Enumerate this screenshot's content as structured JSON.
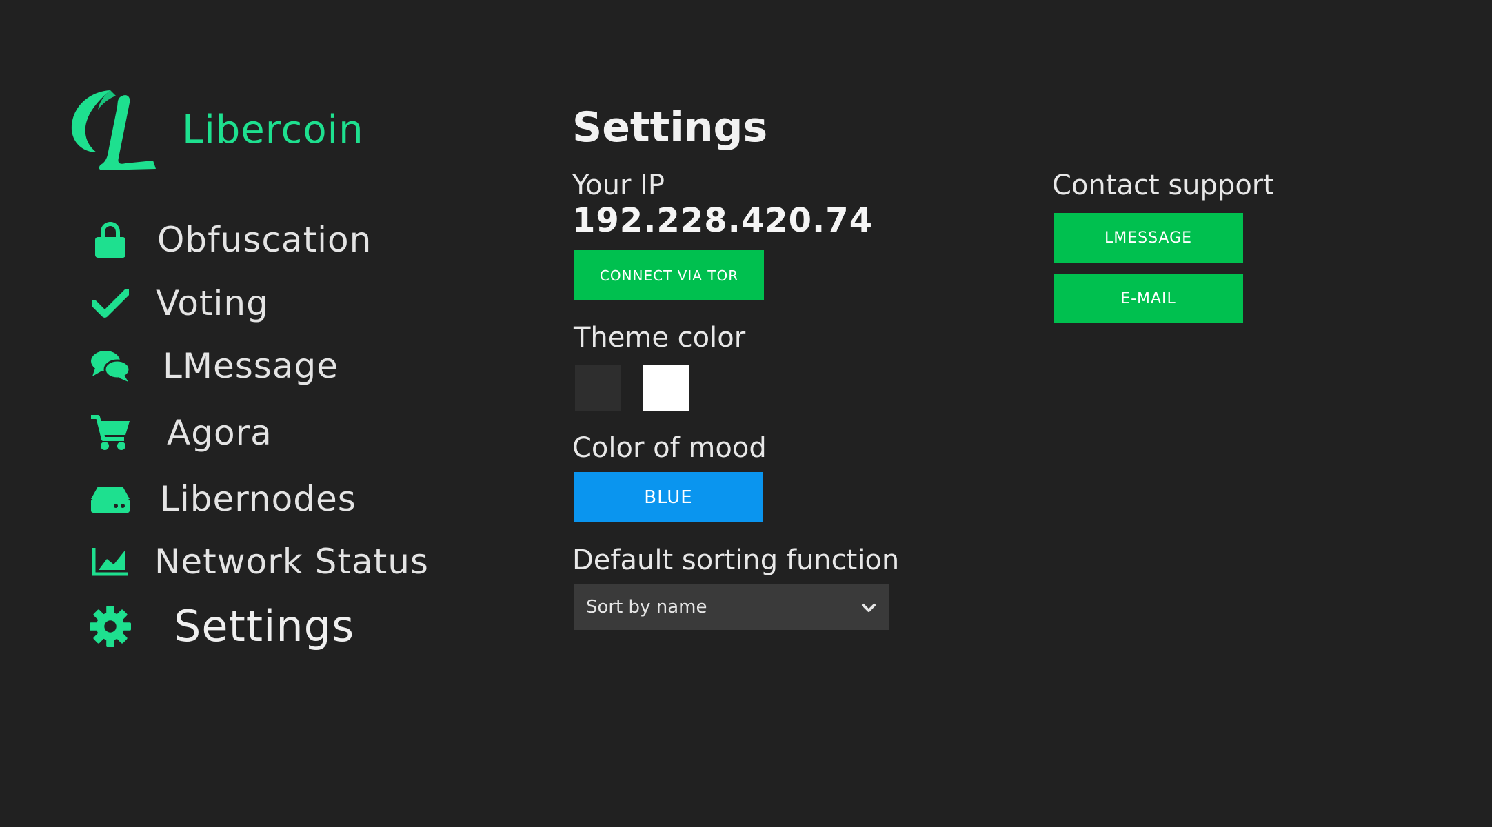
{
  "sidebar": {
    "brand": {
      "name": "Libercoin",
      "logo_icon": "libercoin-logo",
      "accent_color": "#1ee08f"
    },
    "items": [
      {
        "label": "Obfuscation",
        "icon": "lock-icon"
      },
      {
        "label": "Voting",
        "icon": "checkmark-icon"
      },
      {
        "label": "LMessage",
        "icon": "chat-bubbles-icon"
      },
      {
        "label": "Agora",
        "icon": "shopping-cart-icon"
      },
      {
        "label": "Libernodes",
        "icon": "hard-drive-icon"
      },
      {
        "label": "Network Status",
        "icon": "area-chart-icon"
      },
      {
        "label": "Settings",
        "icon": "gear-icon",
        "active": true
      }
    ]
  },
  "main": {
    "title": "Settings",
    "ip": {
      "label": "Your IP",
      "value": "192.228.420.74",
      "connect_button": "CONNECT VIA TOR"
    },
    "theme": {
      "label": "Theme color",
      "options": [
        {
          "name": "dark",
          "color": "#2e2e2e"
        },
        {
          "name": "light",
          "color": "#ffffff"
        }
      ]
    },
    "mood": {
      "label": "Color of mood",
      "button": "BLUE",
      "color": "#0a95ef"
    },
    "sorting": {
      "label": "Default sorting function",
      "selected": "Sort by name"
    },
    "support": {
      "label": "Contact support",
      "lmessage_button": "LMESSAGE",
      "email_button": "E-MAIL"
    }
  },
  "colors": {
    "background": "#212121",
    "button_green": "#00c04f"
  }
}
